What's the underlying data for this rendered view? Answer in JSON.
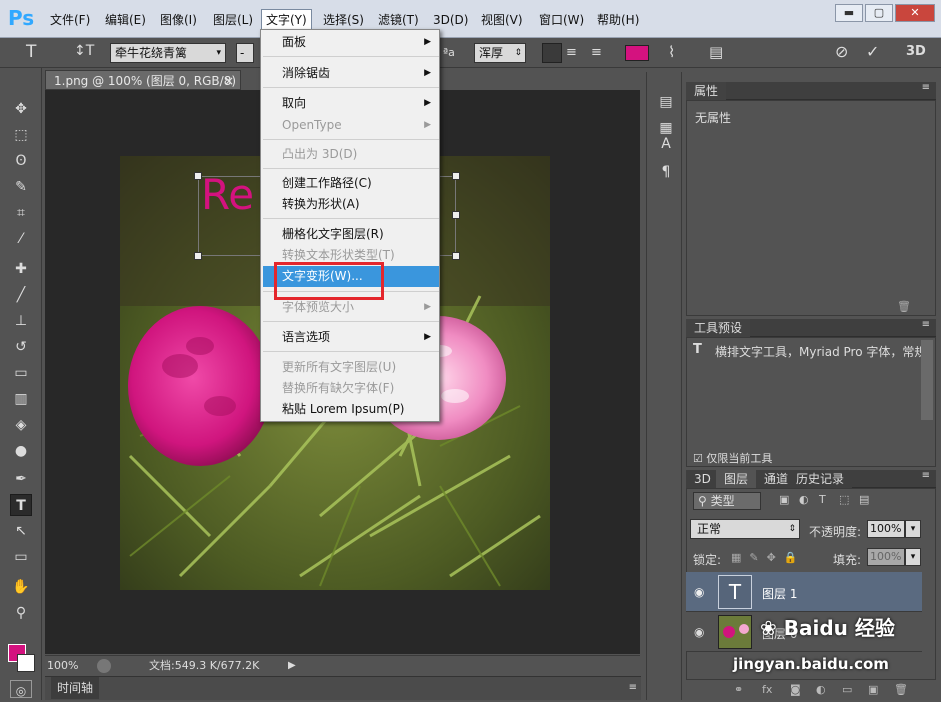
{
  "app": {
    "logo": "Ps"
  },
  "menubar": {
    "items": [
      "文件(F)",
      "编辑(E)",
      "图像(I)",
      "图层(L)",
      "文字(Y)",
      "选择(S)",
      "滤镜(T)",
      "3D(D)",
      "视图(V)",
      "窗口(W)",
      "帮助(H)"
    ],
    "active_index": 4,
    "window_buttons": [
      "▬",
      "▢",
      "✕"
    ]
  },
  "options": {
    "font_family": "牵牛花绕青篱",
    "font_size": "-",
    "aa_label": "ªa",
    "aa_value": "浑厚",
    "text_color": "#d4127f",
    "threed": "3D"
  },
  "document": {
    "tab_title": "1.png @ 100% (图层 0, RGB/8)",
    "tab_close": "×",
    "zoom": "100%",
    "doc_info": "文档:549.3 K/677.2K",
    "overlay_text": "Re"
  },
  "timeline": {
    "label": "时间轴"
  },
  "dropdown": {
    "items": [
      {
        "label": "面板",
        "submenu": true,
        "disabled": false
      },
      {
        "label": "消除锯齿",
        "submenu": true,
        "disabled": false
      },
      {
        "label": "取向",
        "submenu": true,
        "disabled": false
      },
      {
        "label": "OpenType",
        "submenu": true,
        "disabled": true
      },
      {
        "label": "凸出为 3D(D)",
        "submenu": false,
        "disabled": true
      },
      {
        "label": "创建工作路径(C)",
        "submenu": false,
        "disabled": false
      },
      {
        "label": "转换为形状(A)",
        "submenu": false,
        "disabled": false
      },
      {
        "label": "栅格化文字图层(R)",
        "submenu": false,
        "disabled": false
      },
      {
        "label": "转换文本形状类型(T)",
        "submenu": false,
        "disabled": true
      },
      {
        "label": "文字变形(W)...",
        "submenu": false,
        "disabled": false,
        "highlighted": true
      },
      {
        "label": "字体预览大小",
        "submenu": true,
        "disabled": true
      },
      {
        "label": "语言选项",
        "submenu": true,
        "disabled": false
      },
      {
        "label": "更新所有文字图层(U)",
        "submenu": false,
        "disabled": true
      },
      {
        "label": "替换所有缺欠字体(F)",
        "submenu": false,
        "disabled": true
      },
      {
        "label": "粘贴 Lorem Ipsum(P)",
        "submenu": false,
        "disabled": false
      }
    ]
  },
  "properties": {
    "title": "属性",
    "empty": "无属性"
  },
  "tool_presets": {
    "title": "工具预设",
    "item": "横排文字工具，Myriad Pro 字体，常规",
    "current_only": "仅限当前工具"
  },
  "layers_panel": {
    "tabs": [
      "3D",
      "图层",
      "通道",
      "历史记录"
    ],
    "active_tab": 1,
    "kind": "类型",
    "blend_mode": "正常",
    "opacity_label": "不透明度:",
    "opacity_value": "100%",
    "lock_label": "锁定:",
    "fill_label": "填充:",
    "fill_value": "100%",
    "layers": [
      {
        "name": "图层 1",
        "type": "text"
      },
      {
        "name": "图层 0",
        "type": "image"
      }
    ]
  },
  "watermark": {
    "site": "jingyan.baidu.com",
    "brand": "Baidu 经验"
  }
}
